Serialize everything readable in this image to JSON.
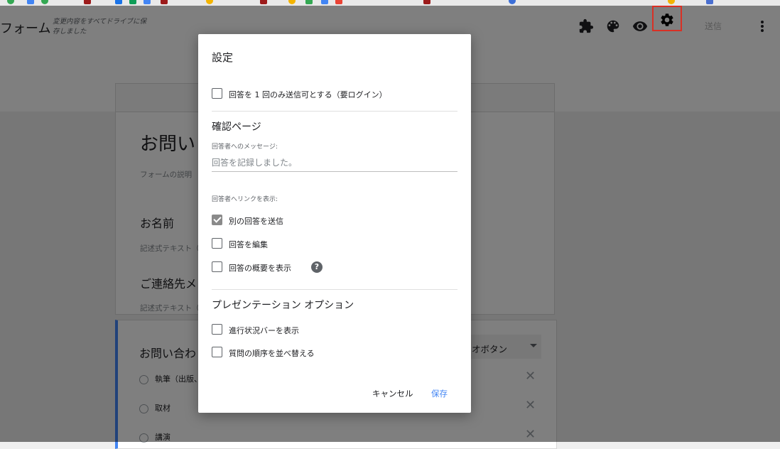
{
  "header": {
    "form_title": "フォーム",
    "saved_note": "変更内容をすべてドライブに保存しました",
    "send_label": "送信",
    "icons": [
      "puzzle-icon",
      "palette-icon",
      "eye-icon",
      "gear-icon",
      "more-vert-icon"
    ]
  },
  "form": {
    "title": "お問い",
    "description": "フォームの説明",
    "questions": [
      {
        "title": "お名前",
        "hint": "記述式テキスト（"
      },
      {
        "title": "ご連絡先メ",
        "hint": "記述式テキスト（"
      }
    ],
    "q3": {
      "title": "お問い合わ",
      "type_label": "オボタン",
      "options": [
        "執筆（出版、",
        "取材",
        "講演"
      ]
    }
  },
  "dialog": {
    "title": "設定",
    "limit_one_response": {
      "label": "回答を 1 回のみ送信可とする（要ログイン）",
      "checked": false
    },
    "confirmation": {
      "section_title": "確認ページ",
      "message_label": "回答者へのメッセージ:",
      "message_placeholder": "回答を記録しました。",
      "links_label": "回答者へリンクを表示:",
      "options": [
        {
          "label": "別の回答を送信",
          "checked": true
        },
        {
          "label": "回答を編集",
          "checked": false
        },
        {
          "label": "回答の概要を表示",
          "checked": false
        }
      ],
      "help_symbol": "?"
    },
    "presentation": {
      "section_title": "プレゼンテーション オプション",
      "options": [
        {
          "label": "進行状況バーを表示",
          "checked": false
        },
        {
          "label": "質問の順序を並べ替える",
          "checked": false
        }
      ]
    },
    "cancel_label": "キャンセル",
    "save_label": "保存"
  },
  "colors": {
    "accent": "#4285f4",
    "highlight": "#d93025",
    "checkbox_checked": "#8a8a8a"
  }
}
